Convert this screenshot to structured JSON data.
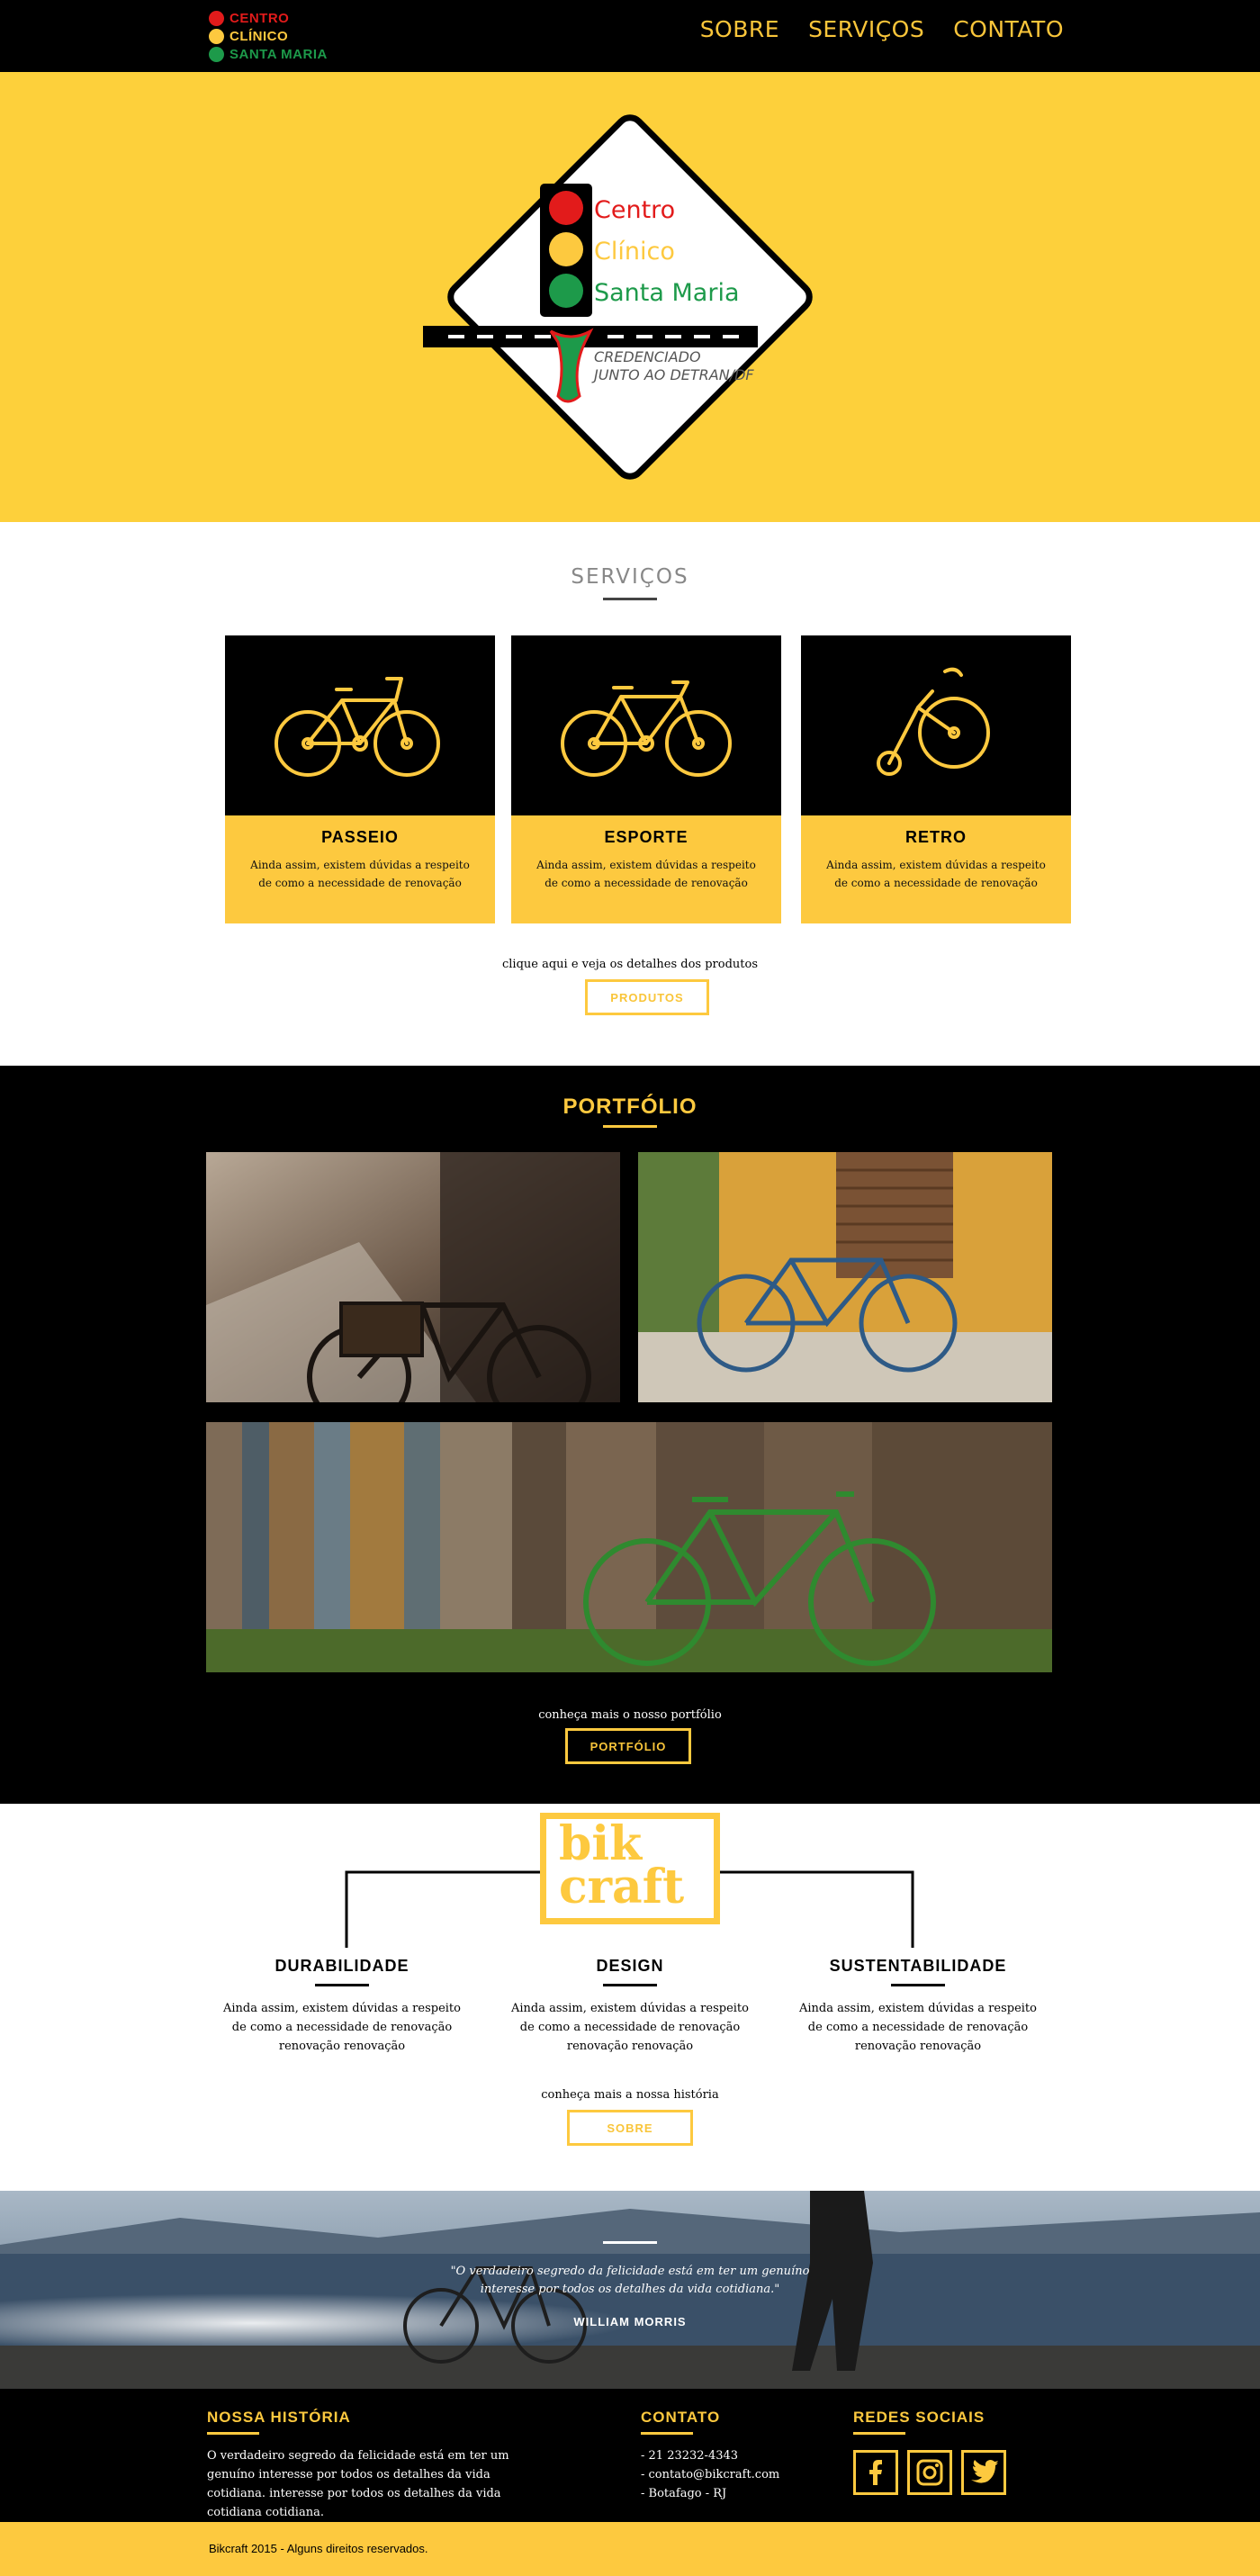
{
  "header": {
    "brand": {
      "line1": "CENTRO",
      "line2": "CLÍNICO",
      "line3": "SANTA MARIA"
    },
    "nav": [
      "SOBRE",
      "SERVIÇOS",
      "CONTATO"
    ]
  },
  "hero": {
    "logo_lines": [
      "Centro",
      "Clínico",
      "Santa Maria"
    ],
    "logo_sub": [
      "CREDENCIADO",
      "JUNTO AO DETRAN/DF"
    ]
  },
  "services": {
    "title": "SERVIÇOS",
    "cards": [
      {
        "title": "PASSEIO",
        "text": "Ainda assim, existem dúvidas a respeito de como a necessidade de renovação",
        "icon": "city-bike-icon"
      },
      {
        "title": "ESPORTE",
        "text": "Ainda assim, existem dúvidas a respeito de como a necessidade de renovação",
        "icon": "road-bike-icon"
      },
      {
        "title": "RETRO",
        "text": "Ainda assim, existem dúvidas a respeito de como a necessidade de renovação",
        "icon": "penny-farthing-icon"
      }
    ],
    "cta_text": "clique aqui e veja os detalhes dos produtos",
    "cta_button": "PRODUTOS"
  },
  "portfolio": {
    "title": "PORTFÓLIO",
    "cta_text": "conheça mais o nosso portfólio",
    "cta_button": "PORTFÓLIO"
  },
  "about": {
    "logo": {
      "line1": "bik",
      "line2": "craft"
    },
    "features": [
      {
        "title": "DURABILIDADE",
        "text": "Ainda assim, existem dúvidas a respeito de como a necessidade de renovação renovação renovação"
      },
      {
        "title": "DESIGN",
        "text": "Ainda assim, existem dúvidas a respeito de como a necessidade de renovação renovação renovação"
      },
      {
        "title": "SUSTENTABILIDADE",
        "text": "Ainda assim, existem dúvidas a respeito de como a necessidade de renovação renovação renovação"
      }
    ],
    "cta_text": "conheça mais a nossa história",
    "cta_button": "SOBRE"
  },
  "quote": {
    "text": "\"O verdadeiro segredo da felicidade está em ter um genuíno interesse por todos os detalhes da vida cotidiana.\"",
    "author": "WILLIAM MORRIS"
  },
  "footer": {
    "history_title": "NOSSA HISTÓRIA",
    "history_text": "O verdadeiro segredo da felicidade está em ter um genuíno interesse por todos os detalhes da vida cotidiana. interesse por todos os detalhes da vida cotidiana cotidiana.",
    "contact_title": "CONTATO",
    "contact_lines": [
      "- 21 23232-4343",
      "- contato@bikcraft.com",
      "- Botafago - RJ"
    ],
    "social_title": "REDES SOCIAIS",
    "social_icons": [
      "facebook-icon",
      "instagram-icon",
      "twitter-icon"
    ],
    "copyright": "Bikcraft 2015 - Alguns direitos reservados."
  },
  "colors": {
    "accent": "#fdc93f",
    "dark": "#000000",
    "hero_bg": "#fdd03b",
    "red": "#e21b1b",
    "green": "#1d9a4a"
  }
}
